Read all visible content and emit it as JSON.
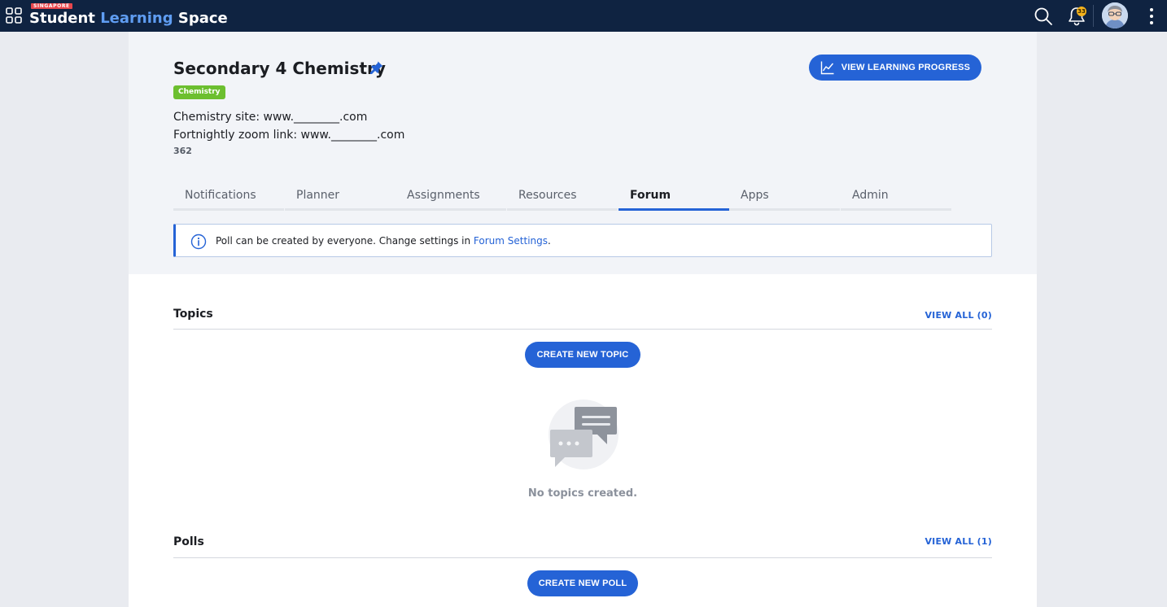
{
  "topbar": {
    "logo_tag": "SINGAPORE",
    "logo_word1": "Student",
    "logo_word2": "Learning",
    "logo_word3": "Space",
    "notification_count": "33"
  },
  "course": {
    "title": "Secondary 4 Chemistry",
    "subject_badge": "Chemistry",
    "description_line1": "Chemistry site: www.________.com",
    "description_line2": "Fortnightly zoom link: www.________.com",
    "count": "362",
    "view_progress_label": "VIEW LEARNING PROGRESS"
  },
  "tabs": [
    {
      "label": "Notifications"
    },
    {
      "label": "Planner"
    },
    {
      "label": "Assignments"
    },
    {
      "label": "Resources"
    },
    {
      "label": "Forum"
    },
    {
      "label": "Apps"
    },
    {
      "label": "Admin"
    }
  ],
  "active_tab": "Forum",
  "info_banner": {
    "text": "Poll can be created by everyone. Change settings in ",
    "link": "Forum Settings",
    "suffix": "."
  },
  "topics": {
    "title": "Topics",
    "view_all": "VIEW ALL (0)",
    "create_label": "CREATE NEW TOPIC",
    "empty_text": "No topics created."
  },
  "polls": {
    "title": "Polls",
    "view_all": "VIEW ALL (1)",
    "create_label": "CREATE NEW POLL"
  },
  "colors": {
    "topbar_bg": "#0f2341",
    "accent": "#2563d6",
    "badge_green": "#6cbf2f",
    "notification_badge": "#f5b31c"
  },
  "icons": [
    "apps-grid-icon",
    "search-icon",
    "bell-icon",
    "avatar",
    "kebab-menu-icon",
    "pin-icon",
    "chart-line-icon",
    "info-icon",
    "chat-bubbles-icon"
  ]
}
